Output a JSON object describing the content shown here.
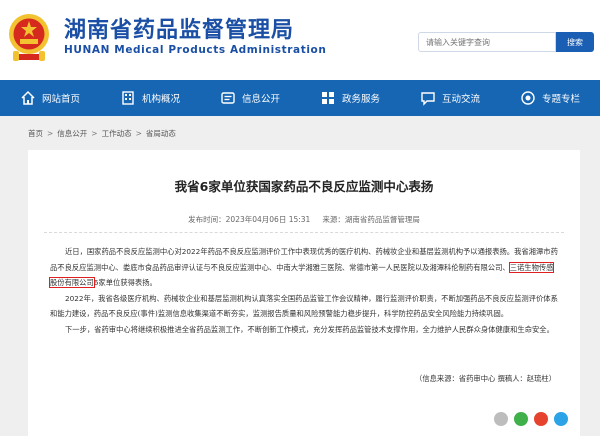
{
  "header": {
    "title_cn": "湖南省药品监督管理局",
    "title_en": "HUNAN Medical Products Administration",
    "search_placeholder": "请输入关键字查询",
    "search_button": "搜索"
  },
  "nav": [
    {
      "label": "网站首页",
      "icon": "home-icon"
    },
    {
      "label": "机构概况",
      "icon": "building-icon"
    },
    {
      "label": "信息公开",
      "icon": "info-icon"
    },
    {
      "label": "政务服务",
      "icon": "grid-icon"
    },
    {
      "label": "互动交流",
      "icon": "chat-icon"
    },
    {
      "label": "专题专栏",
      "icon": "target-icon"
    }
  ],
  "breadcrumb": [
    "首页",
    "信息公开",
    "工作动态",
    "省局动态"
  ],
  "article": {
    "title": "我省6家单位获国家药品不良反应监测中心表扬",
    "meta_date": "发布时间：2023年04月06日 15:31",
    "meta_source": "来源：湖南省药品监督管理局",
    "p1_a": "近日，国家药品不良反应监测中心对2022年药品不良反应监测评价工作中表现优秀的医疗机构、药械妆企业和基层监测机构予以通报表扬。我省湘潭市药品不良反应监测中心、娄底市食品药品审评认证与不良反应监测中心、中南大学湘雅三医院、常德市第一人民医院以及湘潭科伦制药有限公司、",
    "p1_highlight": "三诺生物传感股份有限公司",
    "p1_b": "6家单位获得表扬。",
    "p2": "2022年，我省各级医疗机构、药械妆企业和基层监测机构认真落实全国药品监管工作会议精神，履行监测评价职责，不断加强药品不良反应监测评价体系和能力建设，药品不良反应(事件)监测信息收集渠道不断夯实，监测报告质量和风险预警能力稳步提升，科学防控药品安全风险能力持续巩固。",
    "p3": "下一步，省药审中心将继续积极推进全省药品监测工作，不断创新工作模式，充分发挥药品监管技术支撑作用，全力维护人民群众身体健康和生命安全。",
    "source_line": "（信息来源：省药审中心   撰稿人：赵琉柱）"
  },
  "share_icons": [
    "share-icon",
    "wechat-icon",
    "weibo-icon",
    "qq-icon"
  ],
  "colors": {
    "brand": "#1766b4",
    "title_blue": "#1a4fa5",
    "highlight": "#e02020",
    "emblem_red": "#d62a1f",
    "emblem_gold": "#f2c230"
  }
}
